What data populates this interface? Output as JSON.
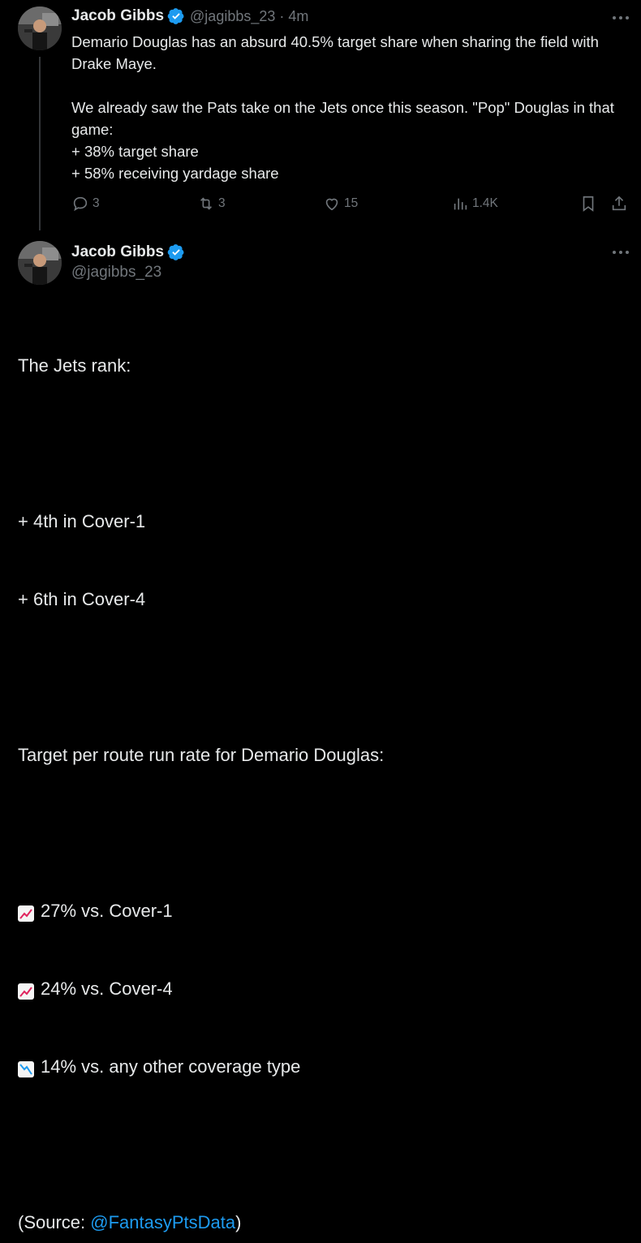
{
  "tweet1": {
    "author_name": "Jacob Gibbs",
    "handle": "@jagibbs_23",
    "separator": "·",
    "time": "4m",
    "text": "Demario Douglas has an absurd 40.5% target share when sharing the field with Drake Maye.\n\nWe already saw the Pats take on the Jets once this season. \"Pop\" Douglas in that game:\n+ 38% target share\n+ 58% receiving yardage share",
    "actions": {
      "replies": "3",
      "reposts": "3",
      "likes": "15",
      "views": "1.4K"
    }
  },
  "tweet2": {
    "author_name": "Jacob Gibbs",
    "handle": "@jagibbs_23",
    "lines": {
      "l1": "The Jets rank:",
      "l2": "+ 4th in Cover-1",
      "l3": "+ 6th in Cover-4",
      "l4": "Target per route run rate for Demario Douglas:",
      "l5": "27% vs. Cover-1",
      "l6": "24% vs. Cover-4",
      "l7": "14% vs. any other coverage type",
      "source_prefix": "(Source: ",
      "source_link": "@FantasyPtsData",
      "source_suffix": ")"
    }
  },
  "icons": [
    "verified-badge-icon",
    "more-options-icon",
    "reply-icon",
    "repost-icon",
    "like-icon",
    "views-icon",
    "bookmark-icon",
    "share-icon",
    "chart-increasing-emoji",
    "chart-decreasing-emoji"
  ],
  "colors": {
    "background": "#000000",
    "text": "#e7e9ea",
    "secondary": "#71767b",
    "accent": "#1d9bf0"
  }
}
